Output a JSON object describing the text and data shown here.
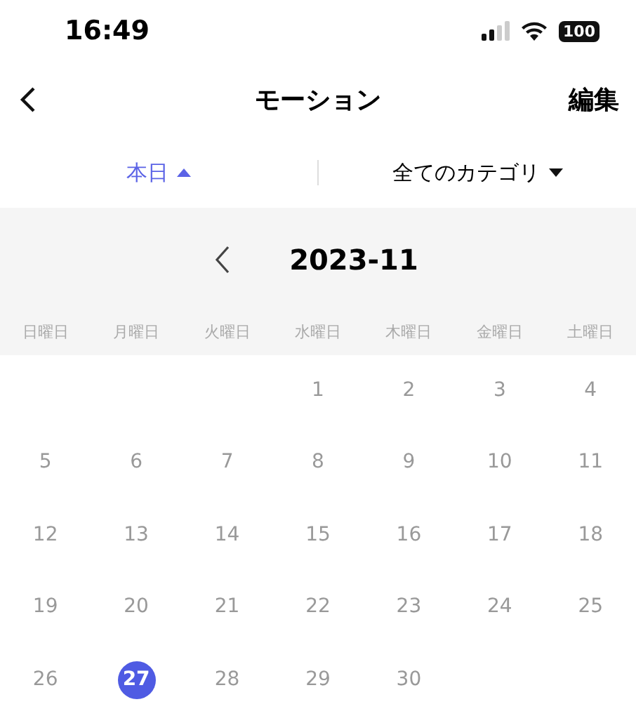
{
  "status_bar": {
    "time": "16:49",
    "battery": "100"
  },
  "nav": {
    "title": "モーション",
    "action": "編集"
  },
  "filters": [
    {
      "label": "本日",
      "selected": true
    },
    {
      "label": "全てのカテゴリ",
      "selected": false
    }
  ],
  "calendar": {
    "month": "2023-11",
    "weekdays": [
      "日曜日",
      "月曜日",
      "火曜日",
      "水曜日",
      "木曜日",
      "金曜日",
      "土曜日"
    ],
    "days": [
      {
        "label": "1",
        "selected": false
      },
      {
        "label": "2",
        "selected": false
      },
      {
        "label": "3",
        "selected": false
      },
      {
        "label": "4",
        "selected": false
      },
      {
        "label": "5",
        "selected": false
      },
      {
        "label": "6",
        "selected": false
      },
      {
        "label": "7",
        "selected": false
      },
      {
        "label": "8",
        "selected": false
      },
      {
        "label": "9",
        "selected": false
      },
      {
        "label": "10",
        "selected": false
      },
      {
        "label": "11",
        "selected": false
      },
      {
        "label": "12",
        "selected": false
      },
      {
        "label": "13",
        "selected": false
      },
      {
        "label": "14",
        "selected": false
      },
      {
        "label": "15",
        "selected": false
      },
      {
        "label": "16",
        "selected": false
      },
      {
        "label": "17",
        "selected": false
      },
      {
        "label": "18",
        "selected": false
      },
      {
        "label": "19",
        "selected": false
      },
      {
        "label": "20",
        "selected": false
      },
      {
        "label": "21",
        "selected": false
      },
      {
        "label": "22",
        "selected": false
      },
      {
        "label": "23",
        "selected": false
      },
      {
        "label": "24",
        "selected": false
      },
      {
        "label": "25",
        "selected": false
      },
      {
        "label": "26",
        "selected": false
      },
      {
        "label": "27",
        "selected": true
      },
      {
        "label": "28",
        "selected": false
      },
      {
        "label": "29",
        "selected": false
      },
      {
        "label": "30",
        "selected": false
      }
    ]
  }
}
